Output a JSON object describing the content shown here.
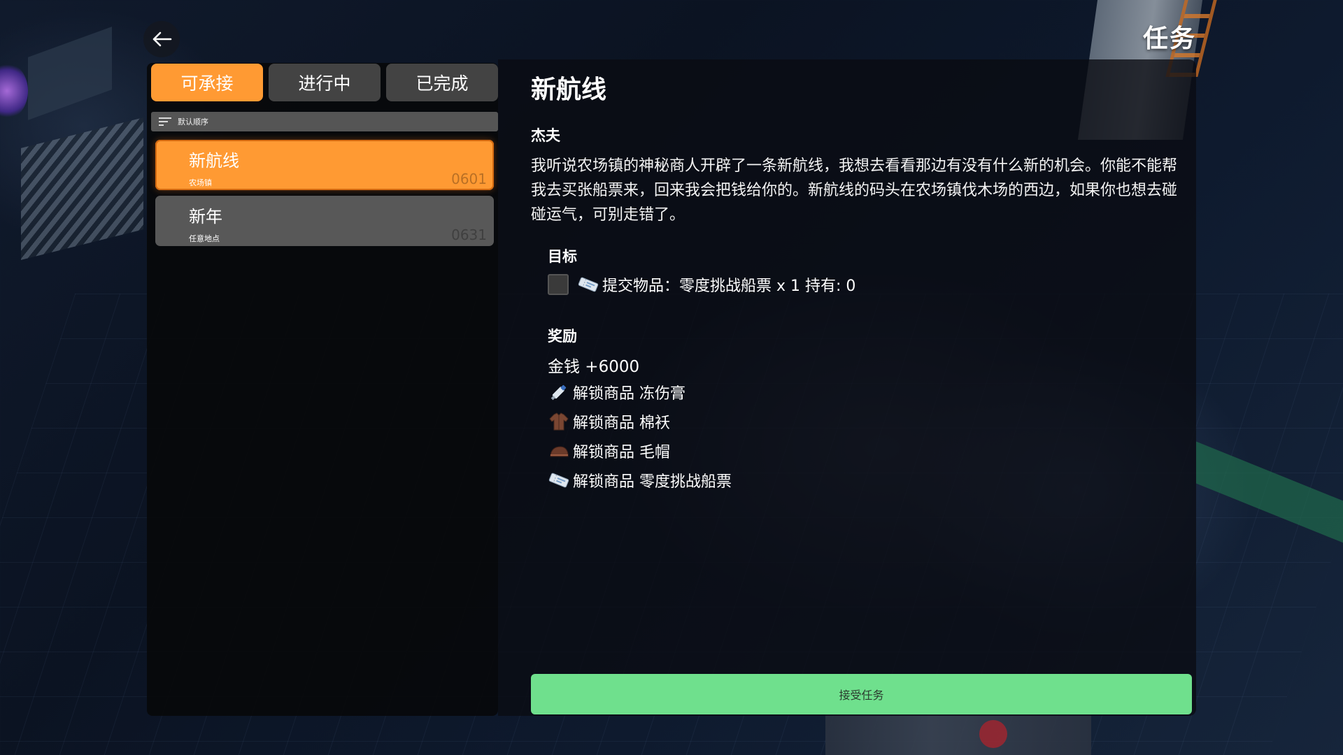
{
  "page": {
    "title": "任务"
  },
  "tabs": [
    {
      "label": "可承接",
      "active": true
    },
    {
      "label": "进行中",
      "active": false
    },
    {
      "label": "已完成",
      "active": false
    }
  ],
  "sort": {
    "label": "默认顺序"
  },
  "quests": [
    {
      "name": "新航线",
      "location": "农场镇",
      "code": "0601",
      "selected": true
    },
    {
      "name": "新年",
      "location": "任意地点",
      "code": "0631",
      "selected": false
    }
  ],
  "detail": {
    "title": "新航线",
    "giver": "杰夫",
    "description": "我听说农场镇的神秘商人开辟了一条新航线，我想去看看那边有没有什么新的机会。你能不能帮我去买张船票来，回来我会把钱给你的。新航线的码头在农场镇伐木场的西边，如果你也想去碰碰运气，可别走错了。",
    "objective_heading": "目标",
    "objective": {
      "text": "提交物品：零度挑战船票 x 1 持有: 0",
      "icon": "ticket-icon",
      "done": false
    },
    "reward_heading": "奖励",
    "money": "金钱 +6000",
    "rewards": [
      {
        "text": "解锁商品 冻伤膏",
        "icon": "tube-icon"
      },
      {
        "text": "解锁商品 棉袄",
        "icon": "coat-icon"
      },
      {
        "text": "解锁商品 毛帽",
        "icon": "hat-icon"
      },
      {
        "text": "解锁商品 零度挑战船票",
        "icon": "ticket-icon"
      }
    ],
    "accept_label": "接受任务"
  },
  "colors": {
    "accent_orange": "#ff9a33",
    "tab_inactive": "#434343",
    "accept_green": "#6fe08d"
  }
}
